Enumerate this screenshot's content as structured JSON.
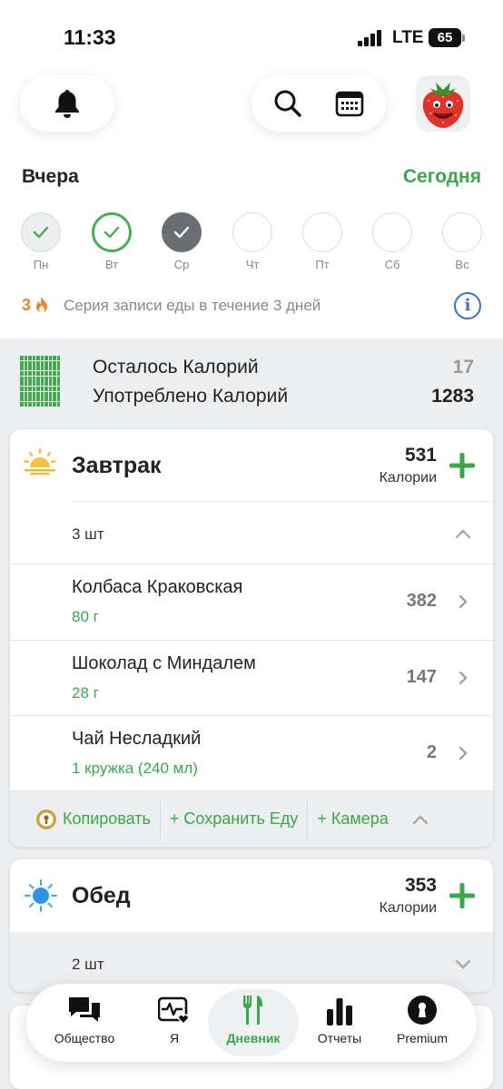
{
  "status_bar": {
    "time": "11:33",
    "network": "LTE",
    "battery": "65"
  },
  "header": {
    "yesterday_label": "Вчера",
    "today_label": "Сегодня"
  },
  "week": [
    {
      "label": "Пн",
      "state": "done"
    },
    {
      "label": "Вт",
      "state": "today"
    },
    {
      "label": "Ср",
      "state": "selected"
    },
    {
      "label": "Чт",
      "state": "empty"
    },
    {
      "label": "Пт",
      "state": "empty"
    },
    {
      "label": "Сб",
      "state": "empty"
    },
    {
      "label": "Вс",
      "state": "empty"
    }
  ],
  "streak": {
    "count": "3",
    "text": "Серия записи еды в течение 3 дней"
  },
  "summary": {
    "remaining_label": "Осталось Калорий",
    "remaining_value": "17",
    "consumed_label": "Употреблено Калорий",
    "consumed_value": "1283"
  },
  "breakfast": {
    "title": "Завтрак",
    "calories": "531",
    "calories_unit": "Калории",
    "count": "3 шт",
    "items": [
      {
        "name": "Колбаса Краковская",
        "portion": "80 г",
        "calories": "382"
      },
      {
        "name": "Шоколад с Миндалем",
        "portion": "28 г",
        "calories": "147"
      },
      {
        "name": "Чай Несладкий",
        "portion": "1 кружка (240 мл)",
        "calories": "2"
      }
    ],
    "actions": {
      "copy": "Копировать",
      "save": "+ Сохранить Еду",
      "camera": "+ Камера"
    }
  },
  "lunch": {
    "title": "Обед",
    "calories": "353",
    "calories_unit": "Калории",
    "count": "2 шт"
  },
  "tabs": [
    {
      "label": "Общество",
      "active": false
    },
    {
      "label": "Я",
      "active": false
    },
    {
      "label": "Дневник",
      "active": true
    },
    {
      "label": "Отчеты",
      "active": false
    },
    {
      "label": "Premium",
      "active": false
    }
  ],
  "colors": {
    "accent": "#3aa74a",
    "streak": "#e8832f",
    "info": "#3e6fc4"
  }
}
